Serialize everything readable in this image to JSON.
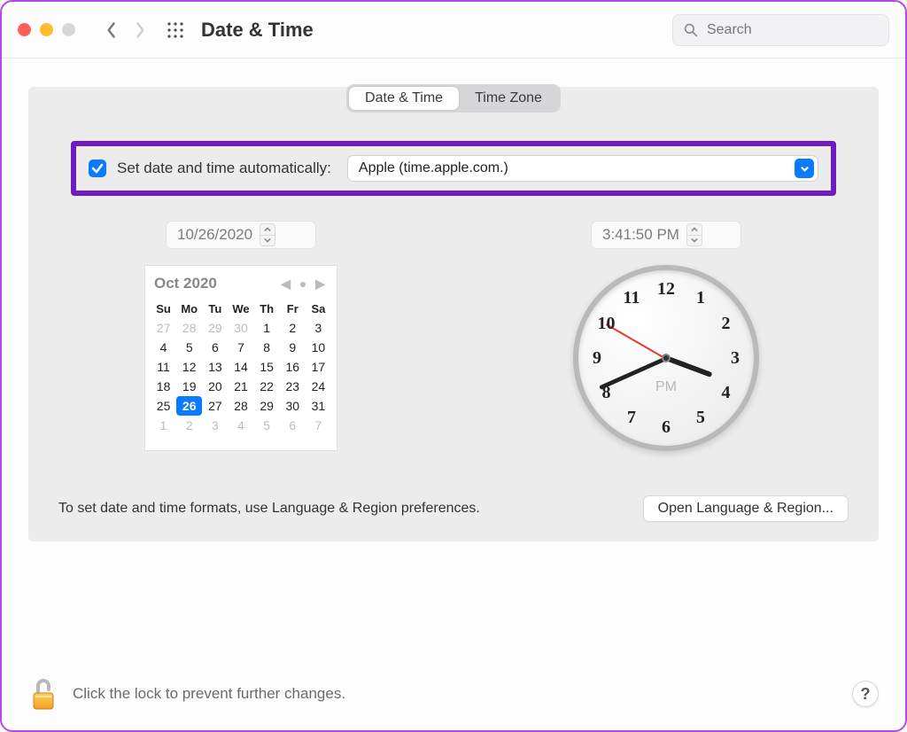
{
  "window": {
    "title": "Date & Time",
    "search_placeholder": "Search"
  },
  "tabs": {
    "date_time": "Date & Time",
    "time_zone": "Time Zone",
    "active": "date_time"
  },
  "auto": {
    "checked": true,
    "label": "Set date and time automatically:",
    "server": "Apple (time.apple.com.)"
  },
  "date_field": "10/26/2020",
  "time_field": "3:41:50 PM",
  "calendar": {
    "month_label": "Oct 2020",
    "weekdays": [
      "Su",
      "Mo",
      "Tu",
      "We",
      "Th",
      "Fr",
      "Sa"
    ],
    "leading": [
      27,
      28,
      29,
      30
    ],
    "days": [
      1,
      2,
      3,
      4,
      5,
      6,
      7,
      8,
      9,
      10,
      11,
      12,
      13,
      14,
      15,
      16,
      17,
      18,
      19,
      20,
      21,
      22,
      23,
      24,
      25,
      26,
      27,
      28,
      29,
      30,
      31
    ],
    "trailing": [
      1,
      2,
      3,
      4,
      5,
      6,
      7
    ],
    "selected": 26
  },
  "clock": {
    "ampm": "PM",
    "hour": 3,
    "minute": 41,
    "second": 50
  },
  "formats": {
    "hint": "To set date and time formats, use Language & Region preferences.",
    "button": "Open Language & Region..."
  },
  "lock": {
    "hint": "Click the lock to prevent further changes."
  }
}
